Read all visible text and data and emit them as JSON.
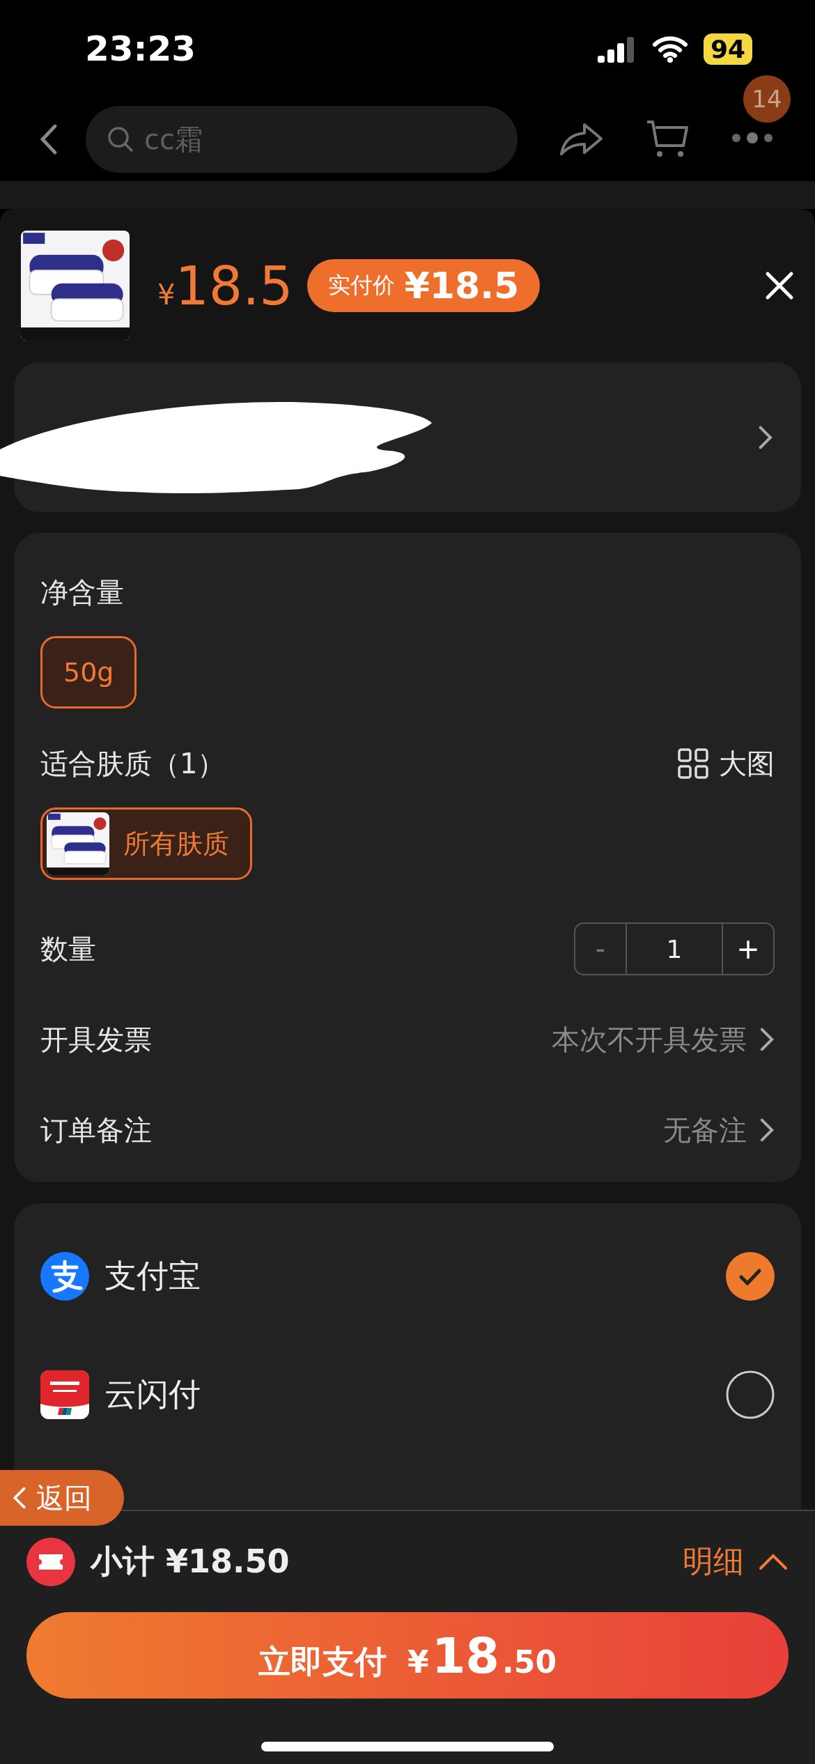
{
  "status_bar": {
    "time": "23:23",
    "battery": "94"
  },
  "nav": {
    "query": "cc霜",
    "badge": "14"
  },
  "product": {
    "price_symbol": "¥",
    "price": "18.5",
    "paid_label": "实付价",
    "paid_price": "¥18.5"
  },
  "option_groups": [
    {
      "title": "净含量",
      "chips": [
        {
          "label": "50g",
          "kind": "text",
          "selected": true
        }
      ]
    },
    {
      "title": "适合肤质（1）",
      "action": "大图",
      "chips": [
        {
          "label": "所有肤质",
          "selected": true
        }
      ]
    }
  ],
  "quantity": {
    "label": "数量",
    "minus": "-",
    "value": "1",
    "plus": "+",
    "minus_disabled": true
  },
  "rows": [
    {
      "label": "开具发票",
      "value": "本次不开具发票"
    },
    {
      "label": "订单备注",
      "value": "无备注"
    }
  ],
  "payments": [
    {
      "name": "支付宝",
      "kind": "alipay",
      "selected": true
    },
    {
      "name": "云闪付",
      "kind": "unionpay",
      "selected": false
    }
  ],
  "back_button": "返回",
  "footer": {
    "subtotal": "小计 ¥18.50",
    "details": "明细",
    "pay_label": "立即支付",
    "pay_symbol": "¥",
    "pay_int": "18",
    "pay_dec": ".50"
  }
}
